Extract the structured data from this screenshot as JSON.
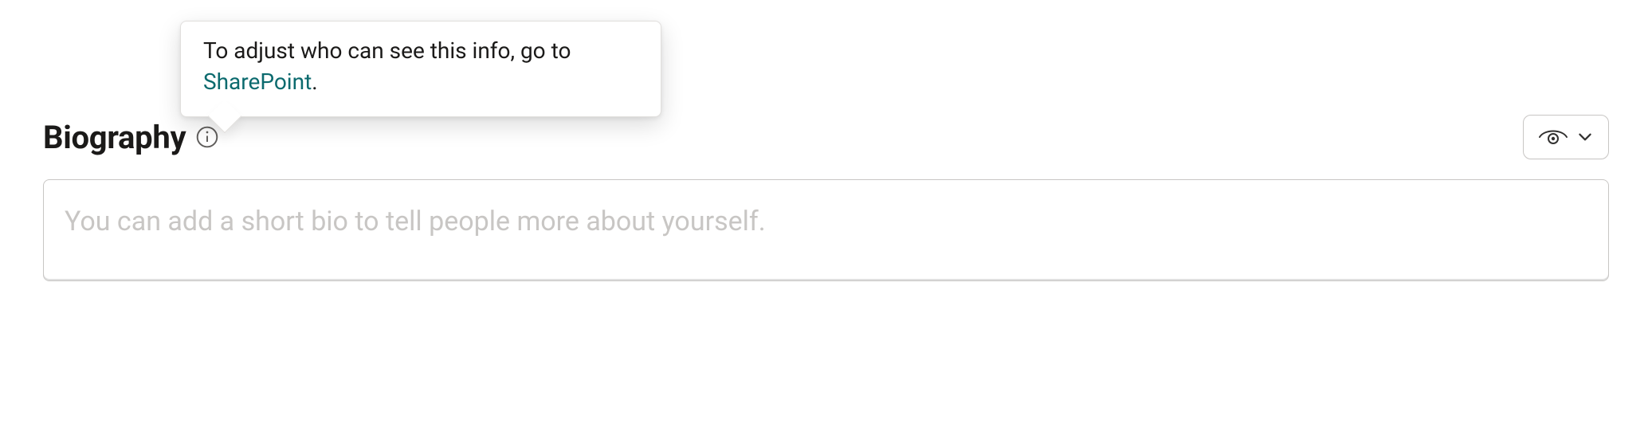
{
  "section": {
    "title": "Biography"
  },
  "tooltip": {
    "text_before_link": "To adjust who can see this info, go to ",
    "link_text": "SharePoint",
    "text_after_link": "."
  },
  "biography_field": {
    "value": "",
    "placeholder": "You can add a short bio to tell people more about yourself."
  },
  "visibility_control": {
    "aria_label": "Change who can see this",
    "state": "Visible"
  }
}
